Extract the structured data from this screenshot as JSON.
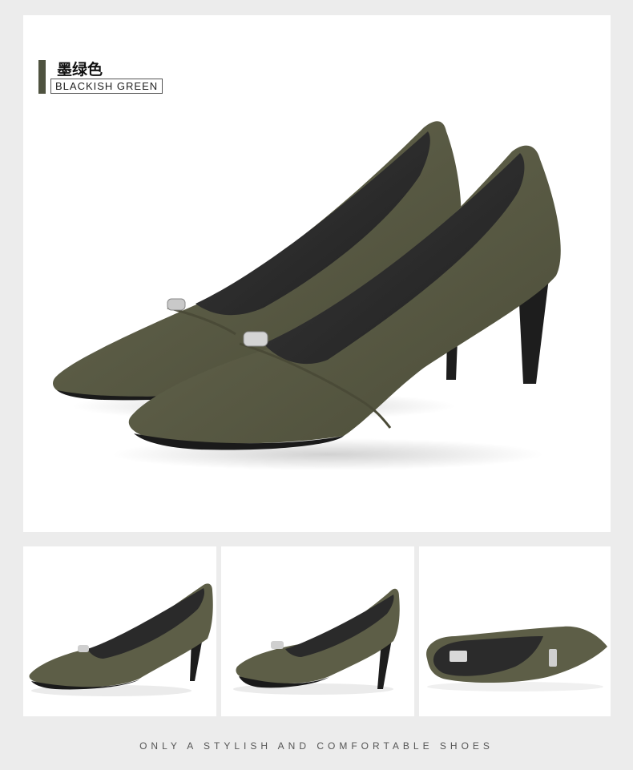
{
  "main_image": {
    "color_name_cn": "墨绿色",
    "color_name_en": "BLACKISH GREEN",
    "accent_color": "#4f5340"
  },
  "thumbnails": [
    {
      "alt": "side-view-left-shoe"
    },
    {
      "alt": "side-view-right-shoe"
    },
    {
      "alt": "top-view-shoe-insole"
    }
  ],
  "colors": {
    "suede": "#5a5b45",
    "suede_dark": "#4a4a37",
    "suede_light": "#6f705a",
    "lining": "#2b2b2b",
    "heel": "#1d1d1d",
    "buckle": "#c9c9c9"
  },
  "footer": {
    "tagline": "ONLY A STYLISH AND COMFORTABLE SHOES"
  }
}
